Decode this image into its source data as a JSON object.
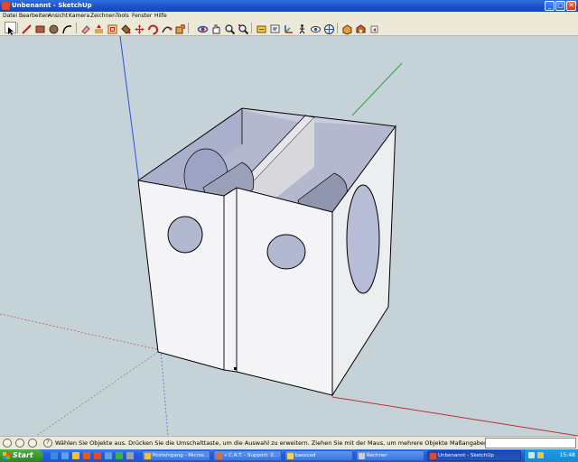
{
  "window": {
    "title": "Unbenannt - SketchUp",
    "controls": {
      "minimize": "_",
      "maximize": "□",
      "close": "✕"
    }
  },
  "menu": [
    "Datei",
    "Bearbeiten",
    "Ansicht",
    "Kamera",
    "Zeichnen",
    "Tools",
    "Fenster",
    "Hilfe"
  ],
  "toolbar": {
    "tools": [
      "select-icon",
      "line-icon",
      "rectangle-icon",
      "circle-icon",
      "arc-icon",
      "eraser-icon",
      "push-pull-icon",
      "offset-icon",
      "paint-bucket-icon",
      "move-icon",
      "rotate-icon",
      "follow-me-icon",
      "scale-icon",
      "orbit-icon",
      "pan-icon",
      "zoom-icon",
      "zoom-extents-icon",
      "tape-measure-icon",
      "text-icon",
      "axes-icon",
      "walk-icon",
      "look-around-icon",
      "position-camera-icon",
      "components-icon",
      "3d-warehouse-icon",
      "share-model-icon",
      "section-plane-icon"
    ]
  },
  "status": {
    "help_glyph": "?",
    "hint": "Wählen Sie Objekte aus. Drücken Sie die Umschalttaste, um die Auswahl zu erweitern. Ziehen Sie mit der Maus, um mehrere Objekte",
    "measurements_label": "Maßangaben",
    "measurements_value": ""
  },
  "taskbar": {
    "start_label": "Start",
    "tasks": [
      {
        "label": "Posteingang - Micros...",
        "icon_color": "#f0c040"
      },
      {
        "label": "« C.A.T. - Support: 0...",
        "icon_color": "#e07030"
      },
      {
        "label": "basscad",
        "icon_color": "#f0d060"
      },
      {
        "label": "Rechner",
        "icon_color": "#d0d0d0"
      },
      {
        "label": "Unbenannt - SketchUp",
        "icon_color": "#e14a2a"
      }
    ],
    "active_task": "Unbenannt - SketchUp",
    "clock": "15:48"
  },
  "colors": {
    "sky": "#c5d2d8",
    "face_front": "#f4f4f6",
    "face_side": "#eef0f2",
    "interior": "#b9bdd3",
    "accent": "#245ddb"
  }
}
